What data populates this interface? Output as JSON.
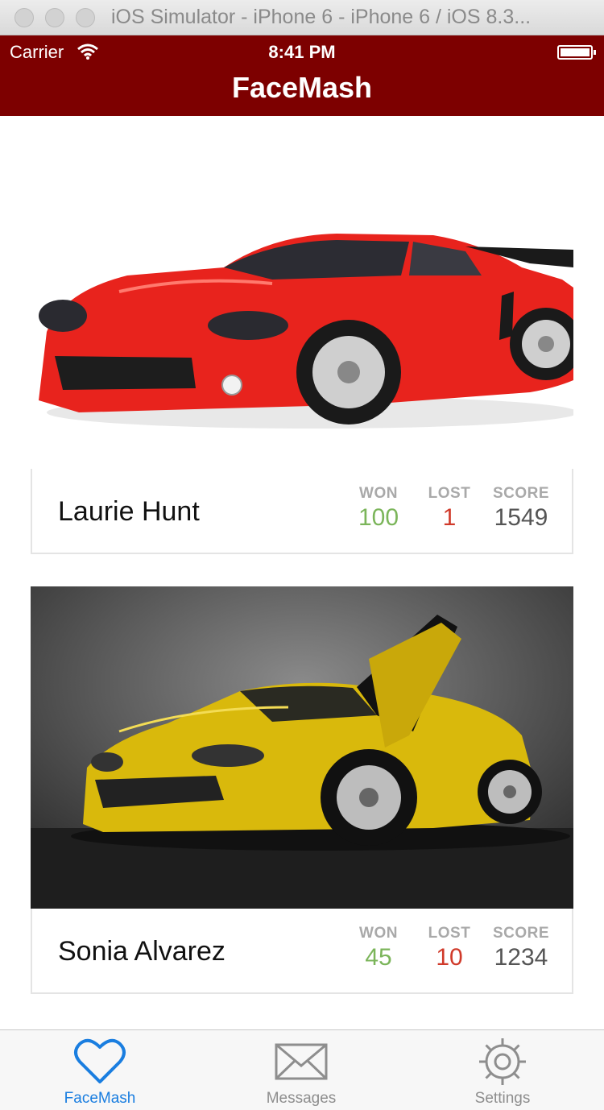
{
  "simulator": {
    "title": "iOS Simulator - iPhone 6 - iPhone 6 / iOS 8.3..."
  },
  "status_bar": {
    "carrier": "Carrier",
    "time": "8:41 PM"
  },
  "nav": {
    "title": "FaceMash",
    "color": "#7d0000"
  },
  "cards": [
    {
      "name": "Laurie Hunt",
      "photo": "red-sports-car",
      "stats": {
        "won_label": "WON",
        "won": "100",
        "lost_label": "LOST",
        "lost": "1",
        "score_label": "SCORE",
        "score": "1549"
      }
    },
    {
      "name": "Sonia Alvarez",
      "photo": "yellow-sports-car",
      "stats": {
        "won_label": "WON",
        "won": "45",
        "lost_label": "LOST",
        "lost": "10",
        "score_label": "SCORE",
        "score": "1234"
      }
    }
  ],
  "tabs": [
    {
      "label": "FaceMash",
      "icon": "heart-icon",
      "active": true
    },
    {
      "label": "Messages",
      "icon": "envelope-icon",
      "active": false
    },
    {
      "label": "Settings",
      "icon": "gear-icon",
      "active": false
    }
  ],
  "colors": {
    "won": "#7bb55a",
    "lost": "#d03a2a",
    "score": "#555555",
    "tab_active": "#1a7ee0"
  }
}
